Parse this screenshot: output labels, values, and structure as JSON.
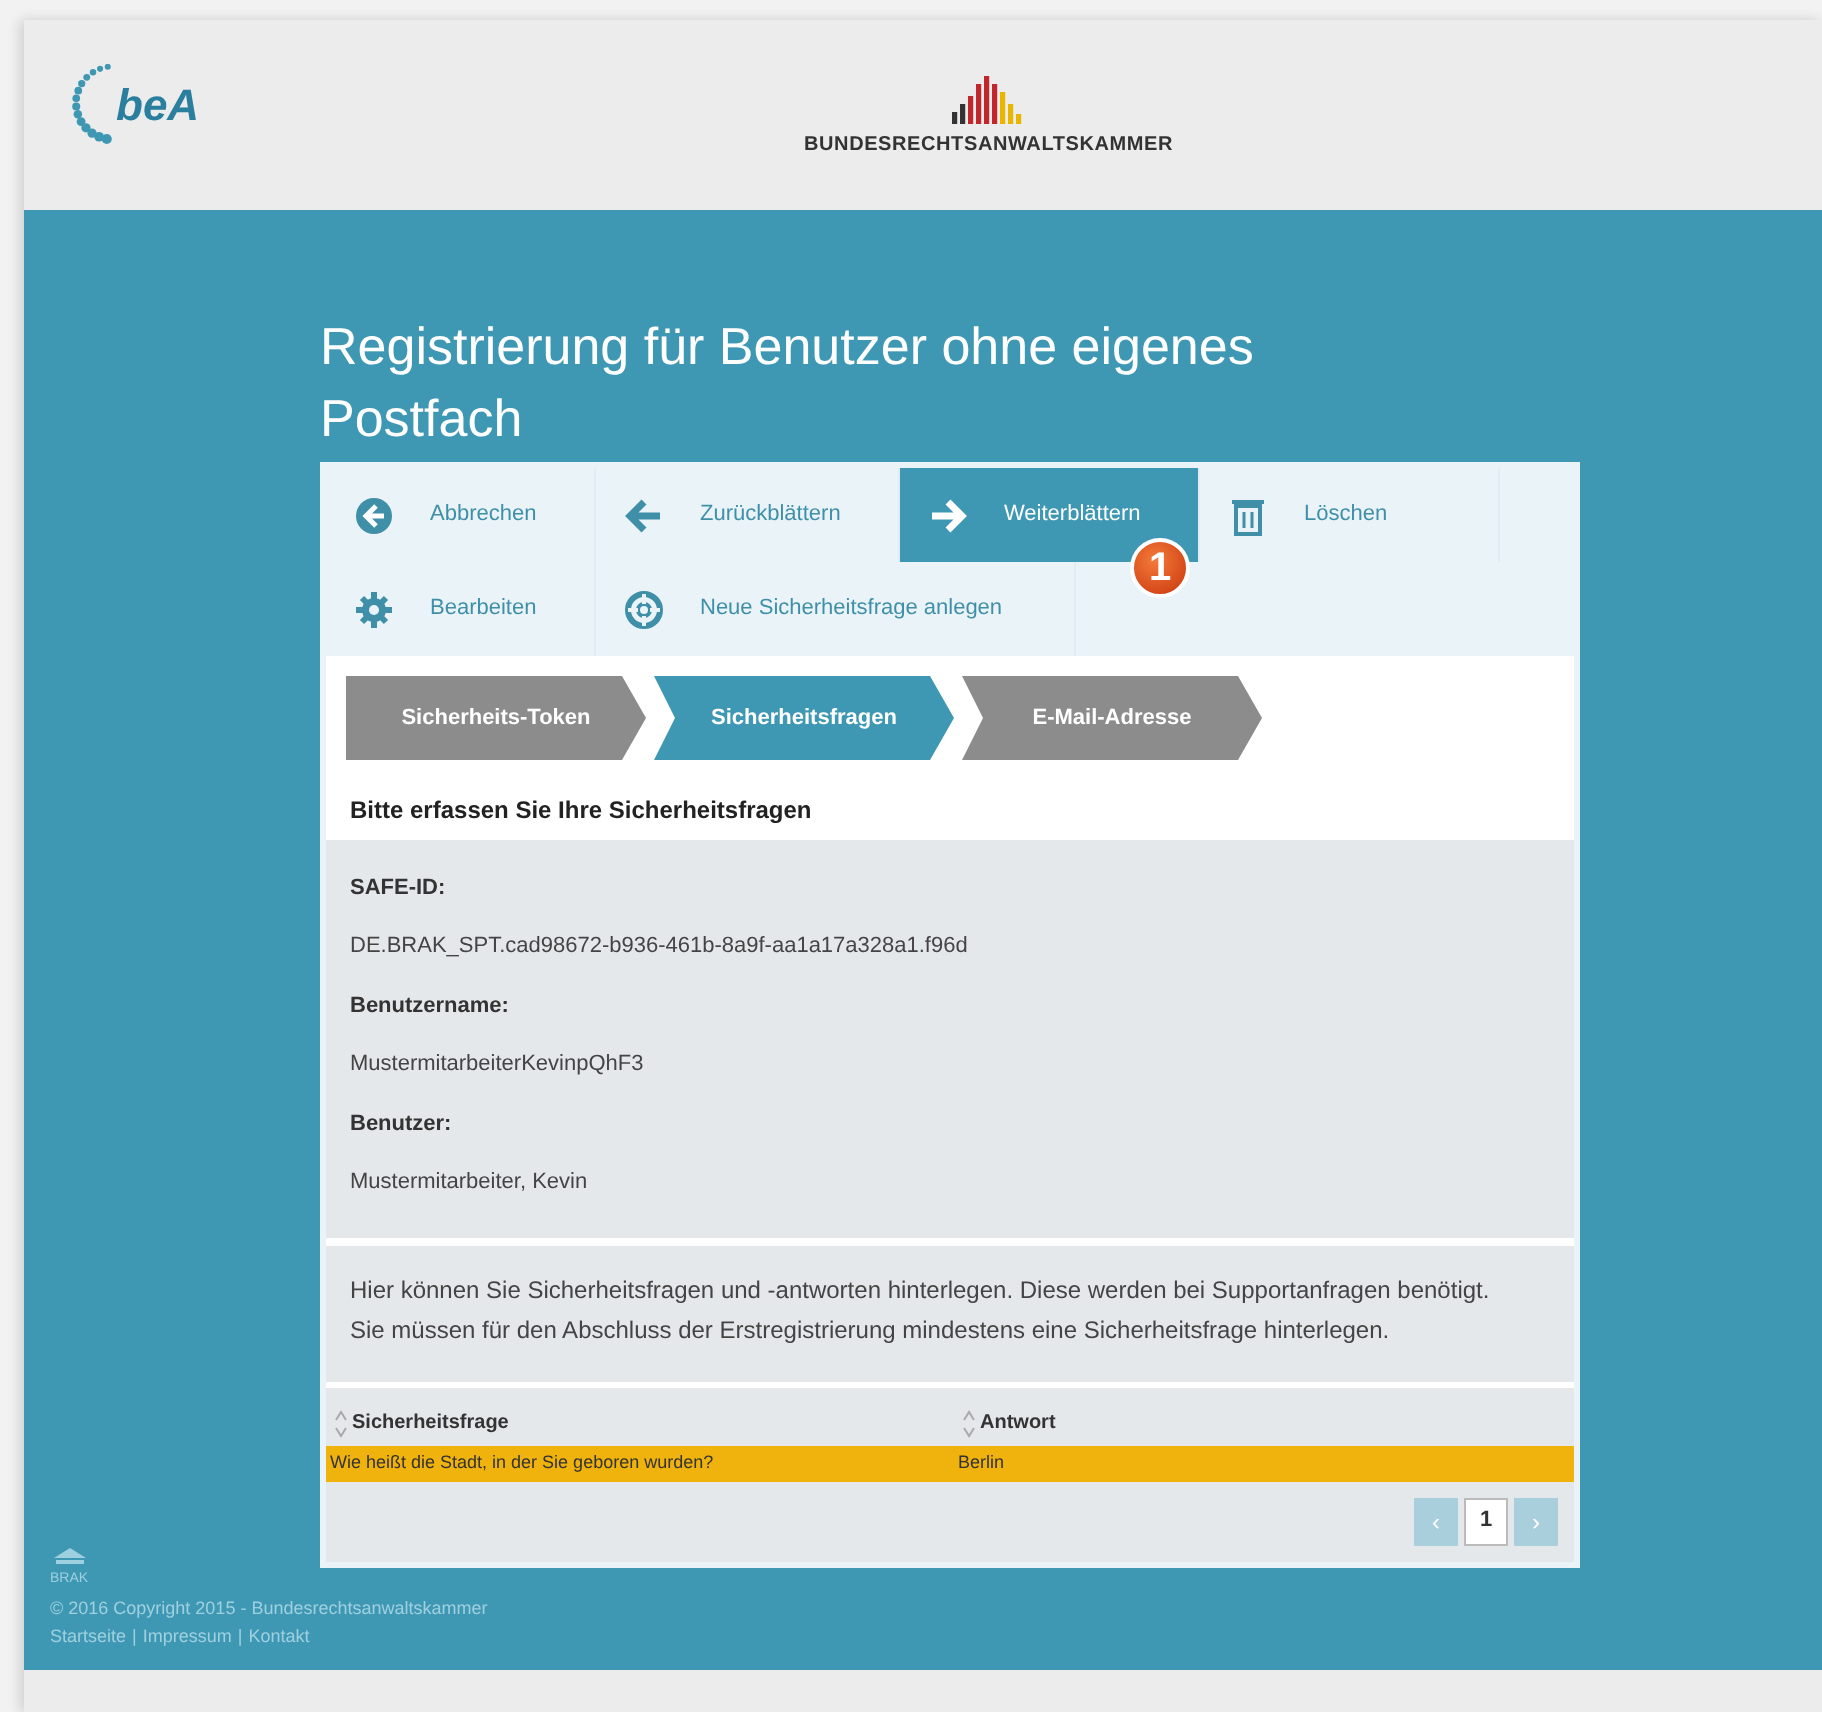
{
  "header": {
    "logo_text": "beA",
    "brand": "BUNDESRECHTSANWALTSKAMMER"
  },
  "title": "Registrierung für Benutzer ohne eigenes Postfach",
  "toolbar": [
    [
      {
        "label": "Abbrechen",
        "kind": "cancel",
        "selected": false
      },
      {
        "label": "Zurückblättern",
        "kind": "back",
        "selected": false
      },
      {
        "label": "Weiterblättern",
        "kind": "forward",
        "selected": true
      },
      {
        "label": "Löschen",
        "kind": "delete",
        "selected": false
      }
    ],
    [
      {
        "label": "Bearbeiten",
        "kind": "edit",
        "selected": false
      },
      {
        "label": "Neue Sicherheitsfrage anlegen",
        "kind": "add",
        "selected": false
      }
    ]
  ],
  "callout": "1",
  "steps": [
    {
      "label": "Sicherheits-Token",
      "selected": false
    },
    {
      "label": "Sicherheitsfragen",
      "selected": true
    },
    {
      "label": "E-Mail-Adresse",
      "selected": false
    }
  ],
  "section_heading": "Bitte erfassen Sie Ihre Sicherheitsfragen",
  "fields": [
    {
      "label": "SAFE-ID:",
      "value": "DE.BRAK_SPT.cad98672-b936-461b-8a9f-aa1a17a328a1.f96d"
    },
    {
      "label": "Benutzername:",
      "value": "MustermitarbeiterKevinpQhF3"
    },
    {
      "label": "Benutzer:",
      "value": "Mustermitarbeiter, Kevin"
    }
  ],
  "description": "Hier können Sie Sicherheitsfragen und -antworten hinterlegen. Diese werden bei Supportanfragen benötigt. Sie müssen für den Abschluss der Erstregistrierung mindestens eine Sicherheitsfrage hinterlegen.",
  "table": {
    "columns": [
      "Sicherheitsfrage",
      "Antwort"
    ],
    "rows": [
      {
        "cells": [
          "Wie heißt die Stadt, in der Sie geboren wurden?",
          "Berlin"
        ],
        "selected": true
      }
    ]
  },
  "pagination": {
    "prev": "‹",
    "pages": [
      {
        "label": "1",
        "selected": true
      }
    ],
    "next": "›"
  },
  "footer": {
    "mark": "BRAK",
    "copyright": "© 2016 Copyright 2015 - Bundesrechtsanwaltskammer",
    "links": [
      "Startseite",
      "Impressum",
      "Kontakt"
    ],
    "separator": "|"
  }
}
